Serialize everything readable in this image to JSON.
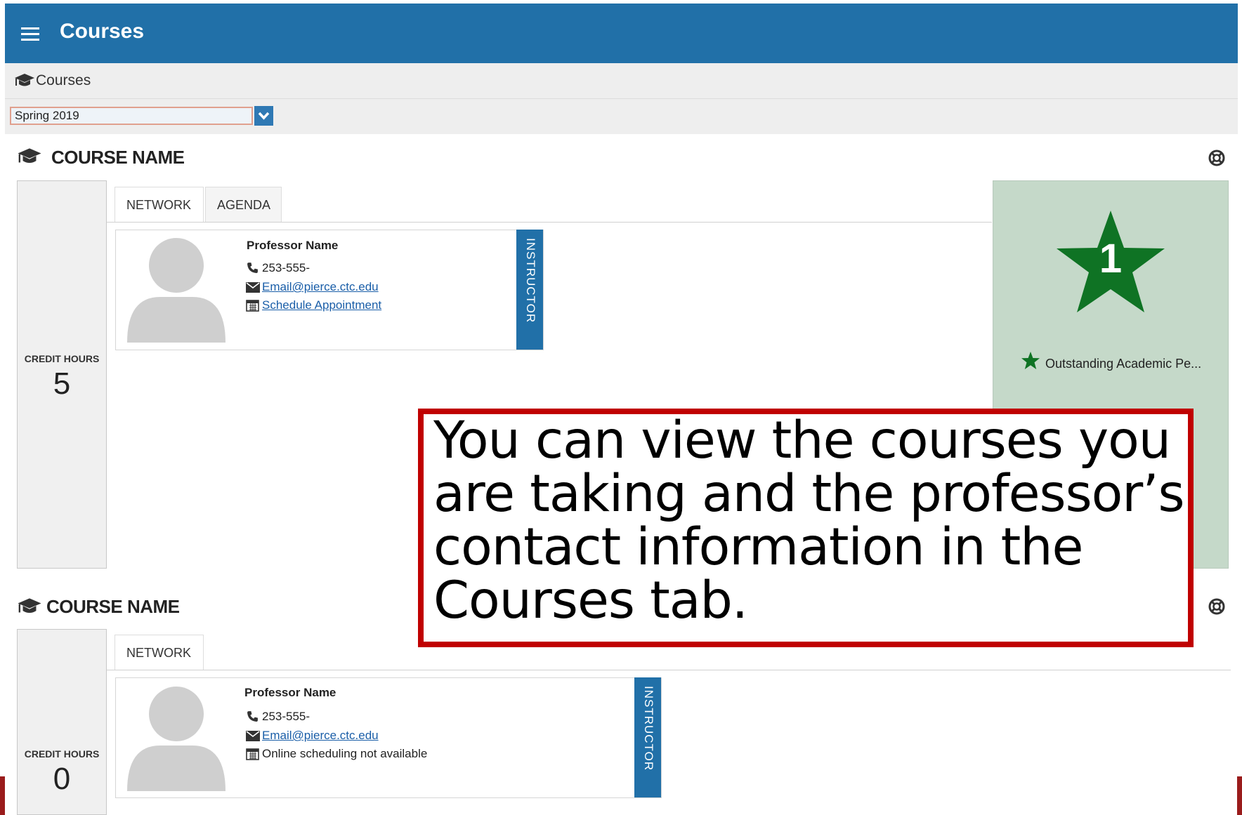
{
  "app": {
    "title": "Courses"
  },
  "breadcrumb": {
    "label": "Courses"
  },
  "term_select": {
    "value": "Spring 2019"
  },
  "courses": [
    {
      "name": "COURSE NAME",
      "credit_label": "CREDIT HOURS",
      "credit_hours": "5",
      "tabs": [
        "NETWORK",
        "AGENDA"
      ],
      "instructor": {
        "name": "Professor Name",
        "phone": "253-555-",
        "email": "Email@pierce.ctc.edu",
        "schedule": "Schedule Appointment",
        "role": "INSTRUCTOR"
      },
      "award": {
        "count": "1",
        "label": "Outstanding Academic Pe...",
        "color": "#0f7324"
      }
    },
    {
      "name": "COURSE NAME",
      "credit_label": "CREDIT HOURS",
      "credit_hours": "0",
      "tabs": [
        "NETWORK"
      ],
      "instructor": {
        "name": "Professor Name",
        "phone": "253-555-",
        "email": "Email@pierce.ctc.edu",
        "schedule": "Online scheduling not available",
        "role": "INSTRUCTOR"
      }
    }
  ],
  "callout": {
    "text": "You can view the courses you are taking and the professor’s contact information in the Courses tab."
  },
  "colors": {
    "header": "#2170a8",
    "callout_border": "#c00000",
    "award_bg": "#c5d9c9"
  },
  "icons": [
    "menu-icon",
    "graduation-cap-icon",
    "chevron-down-icon",
    "lifebuoy-icon",
    "phone-icon",
    "envelope-icon",
    "calendar-icon",
    "star-icon",
    "avatar-icon"
  ]
}
